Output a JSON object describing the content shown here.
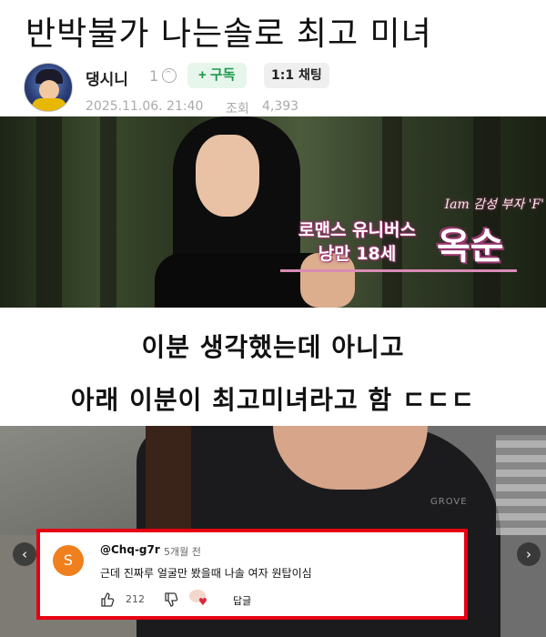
{
  "post": {
    "title": "반박불가 나는솔로 최고 미녀",
    "author": "댕시니",
    "level": "1",
    "subscribe_label": "+ 구독",
    "chat_label": "1:1 채팅",
    "date": "2025.11.06. 21:40",
    "views_label": "조회",
    "views": "4,393"
  },
  "image1": {
    "caption_small": "Iam 감성 부자 'F'",
    "caption_line1": "로맨스 유니버스",
    "caption_line2": "낭만 18세",
    "caption_name": "옥순"
  },
  "body": {
    "line1": "이분 생각했는데 아니고",
    "line2": "아래 이분이 최고미녀라고 함 ㄷㄷㄷ"
  },
  "image2": {
    "logo_text": "GROVE",
    "comment": {
      "avatar_letter": "S",
      "user": "@Chq-g7r",
      "time": "5개월 전",
      "text": "근데 진짜루 얼굴만 봤을때 나솔 여자 원탑이심",
      "likes": "212",
      "reply_label": "답글"
    },
    "nav_prev": "‹",
    "nav_next": "›"
  },
  "colors": {
    "subscribe_bg": "#e6f6ea",
    "subscribe_text": "#1b9a4b",
    "highlight_border": "#e60012",
    "comment_avatar": "#f07f1e"
  },
  "icons": [
    "level-badge-icon",
    "thumbs-up-icon",
    "thumbs-down-icon",
    "heart-icon",
    "chevron-left-icon",
    "chevron-right-icon"
  ]
}
